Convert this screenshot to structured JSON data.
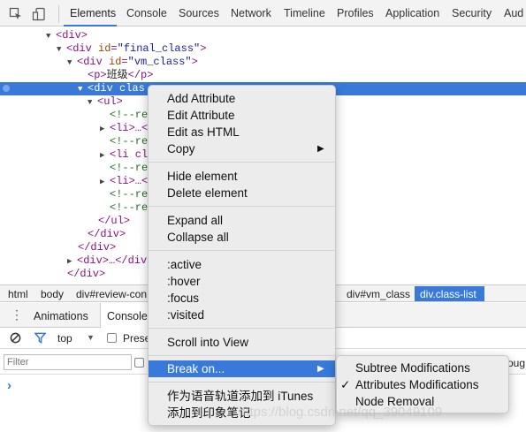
{
  "toolbar": {
    "tabs": [
      {
        "label": "Elements"
      },
      {
        "label": "Console"
      },
      {
        "label": "Sources"
      },
      {
        "label": "Network"
      },
      {
        "label": "Timeline"
      },
      {
        "label": "Profiles"
      },
      {
        "label": "Application"
      },
      {
        "label": "Security"
      },
      {
        "label": "Aud"
      }
    ],
    "icons": [
      "inspect-cursor-icon",
      "device-mode-icon"
    ],
    "accent": "#3879d9"
  },
  "tree": {
    "l0": {
      "open": "<div>"
    },
    "l1": {
      "tag": "<div",
      "attr": "id",
      "val": "\"final_class\"",
      "end": ">"
    },
    "l2": {
      "tag": "<div",
      "attr": "id",
      "val": "\"vm_class\"",
      "end": ">"
    },
    "l3": {
      "open": "<p>",
      "text": "班级",
      "close": "</p>"
    },
    "l4": {
      "tag": "<div",
      "attr": "clas"
    },
    "l5": {
      "open": "<ul>"
    },
    "c1": "<!--re",
    "li1": "<li>…<",
    "c2": "<!--re",
    "li2": "<li cl",
    "c3": "<!--re",
    "li3": "<li>…<",
    "c4": "<!--re",
    "c5": "<!--re",
    "ul_close": "</ul>",
    "div_close1": "</div>",
    "div_close2": "</div>",
    "div_collapsed": "<div>…</div>",
    "div_close3": "</div>"
  },
  "breadcrumb": {
    "items": [
      "html",
      "body",
      "div#review-con",
      "div#vm_class",
      "div.class-list"
    ]
  },
  "drawer": {
    "tabs": [
      {
        "label": "Animations"
      },
      {
        "label": "Console"
      }
    ],
    "context": "top",
    "preserve_label": "Prese",
    "filter_placeholder": "Filter",
    "prompt": "›",
    "right_text": "oug"
  },
  "context_menu": {
    "groups": [
      [
        "Add Attribute",
        "Edit Attribute",
        "Edit as HTML",
        "Copy"
      ],
      [
        "Hide element",
        "Delete element"
      ],
      [
        "Expand all",
        "Collapse all"
      ],
      [
        ":active",
        ":hover",
        ":focus",
        ":visited"
      ],
      [
        "Scroll into View"
      ],
      [
        "Break on..."
      ],
      [
        "作为语音轨道添加到 iTunes",
        "添加到印象笔记"
      ]
    ],
    "highlighted": "Break on...",
    "highlight_color": "#3879d9"
  },
  "submenu": {
    "items": [
      "Subtree Modifications",
      "Attributes Modifications",
      "Node Removal"
    ],
    "checked": "Attributes Modifications",
    "check_glyph": "✓"
  },
  "watermark": "https://blog.csdn.net/qq_39049109"
}
